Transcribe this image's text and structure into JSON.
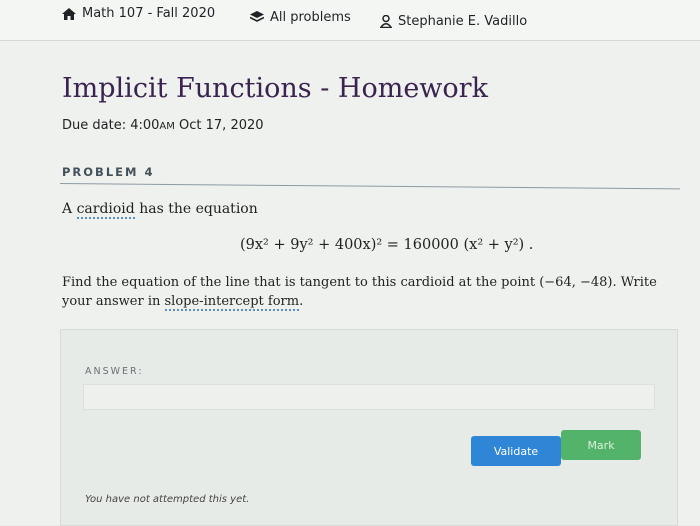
{
  "nav": {
    "course": "Math 107 - Fall 2020",
    "problems": "All problems",
    "user": "Stephanie E. Vadillo"
  },
  "page": {
    "title": "Implicit Functions - Homework",
    "due_prefix": "Due date: ",
    "due_time": "4:00",
    "due_ampm": "AM",
    "due_date": " Oct 17, 2020"
  },
  "problem": {
    "label": "PROBLEM 4",
    "statement_pre": "A ",
    "statement_term": "cardioid",
    "statement_post": " has the equation",
    "equation": "(9x² + 9y² + 400x)² = 160000 (x² + y²) .",
    "question_part1": "Find the equation of the line that is tangent to this cardioid at the point (−64, −48). Write your answer in ",
    "question_link": "slope-intercept form",
    "question_end": "."
  },
  "answer": {
    "label": "ANSWER:",
    "value": "",
    "validate_label": "Validate",
    "mark_label": "Mark",
    "status": "You have not attempted this yet."
  },
  "colors": {
    "title": "#3a2350",
    "validate": "#2f86d6",
    "mark": "#54b36a",
    "dotted_underline": "#5b8fc0"
  },
  "icons": {
    "course": "home-icon",
    "problems": "stack-icon",
    "user": "user-icon"
  }
}
